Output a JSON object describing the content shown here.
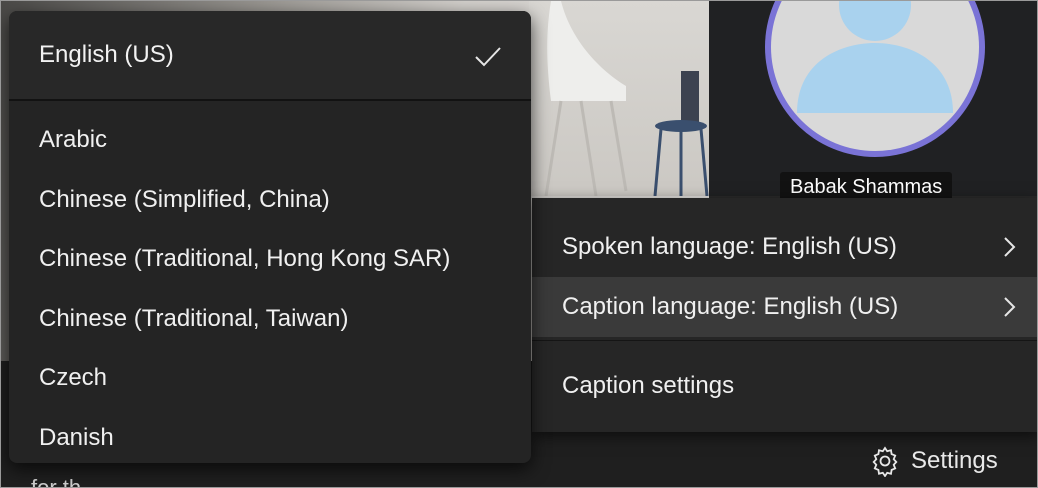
{
  "participant": {
    "name": "Babak Shammas"
  },
  "language_menu": {
    "selected": "English (US)",
    "items": [
      "Arabic",
      "Chinese (Simplified, China)",
      "Chinese (Traditional, Hong Kong SAR)",
      "Chinese (Traditional, Taiwan)",
      "Czech",
      "Danish"
    ]
  },
  "captions_menu": {
    "spoken_language": "Spoken language: English (US)",
    "caption_language": "Caption language: English (US)",
    "caption_settings": "Caption settings"
  },
  "toolbar": {
    "settings_label": "Settings"
  },
  "background_text": "for th",
  "colors": {
    "avatar_ring": "#7a73d6",
    "avatar_person": "#a9d2ee",
    "menu_bg": "#242424"
  }
}
